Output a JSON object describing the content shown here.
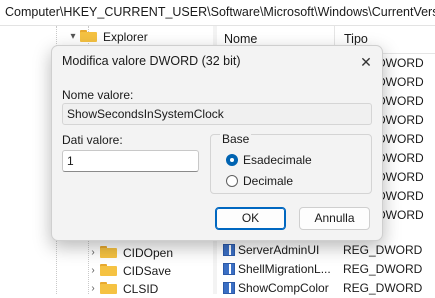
{
  "address_bar": {
    "path": "Computer\\HKEY_CURRENT_USER\\Software\\Microsoft\\Windows\\CurrentVersion\\Ex"
  },
  "tree": {
    "top_item": {
      "label": "Explorer",
      "chevron": "expanded"
    },
    "bottom_items": [
      {
        "label": "CIDOpen",
        "chevron": "collapsed"
      },
      {
        "label": "CIDSave",
        "chevron": "collapsed"
      },
      {
        "label": "CLSID",
        "chevron": "collapsed"
      }
    ]
  },
  "list": {
    "columns": {
      "name": "Nome",
      "type": "Tipo"
    },
    "hidden_type_rows": [
      "DWORD",
      "DWORD",
      "DWORD",
      "DWORD",
      "DWORD",
      "DWORD",
      "DWORD",
      "DWORD",
      "DWORD"
    ],
    "rows": [
      {
        "name": "ServerAdminUI",
        "type": "REG_DWORD",
        "icon": "dword-value-icon"
      },
      {
        "name": "ShellMigrationL...",
        "type": "REG_DWORD",
        "icon": "dword-value-icon"
      },
      {
        "name": "ShowCompColor",
        "type": "REG_DWORD",
        "icon": "dword-value-icon"
      }
    ]
  },
  "dialog": {
    "title": "Modifica valore DWORD (32 bit)",
    "close_glyph": "✕",
    "name_label": "Nome valore:",
    "name_value": "ShowSecondsInSystemClock",
    "data_label": "Dati valore:",
    "data_value": "1",
    "base_label": "Base",
    "radio_hex": "Esadecimale",
    "radio_dec": "Decimale",
    "selected_base": "Esadecimale",
    "ok_label": "OK",
    "cancel_label": "Annulla",
    "accent_color": "#0067c0"
  }
}
